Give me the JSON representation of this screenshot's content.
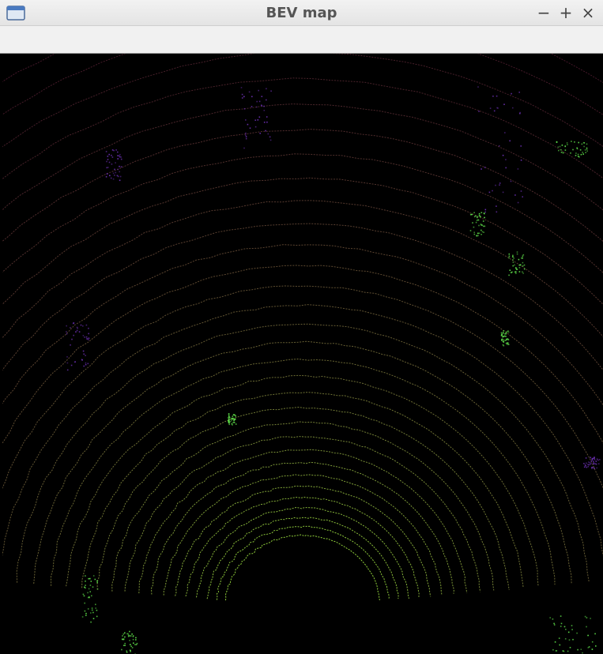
{
  "window": {
    "title": "BEV map",
    "controls": {
      "minimize": "−",
      "maximize": "+",
      "close": "×"
    }
  },
  "colors": {
    "background": "#000000",
    "near_points": "#8fce3a",
    "far_points": "#7a2a4a",
    "object_points_low": "#6a2fb0",
    "object_points_high": "#5fe04a"
  },
  "icons": [
    "app-window-icon",
    "minimize-icon",
    "maximize-icon",
    "close-icon"
  ]
}
